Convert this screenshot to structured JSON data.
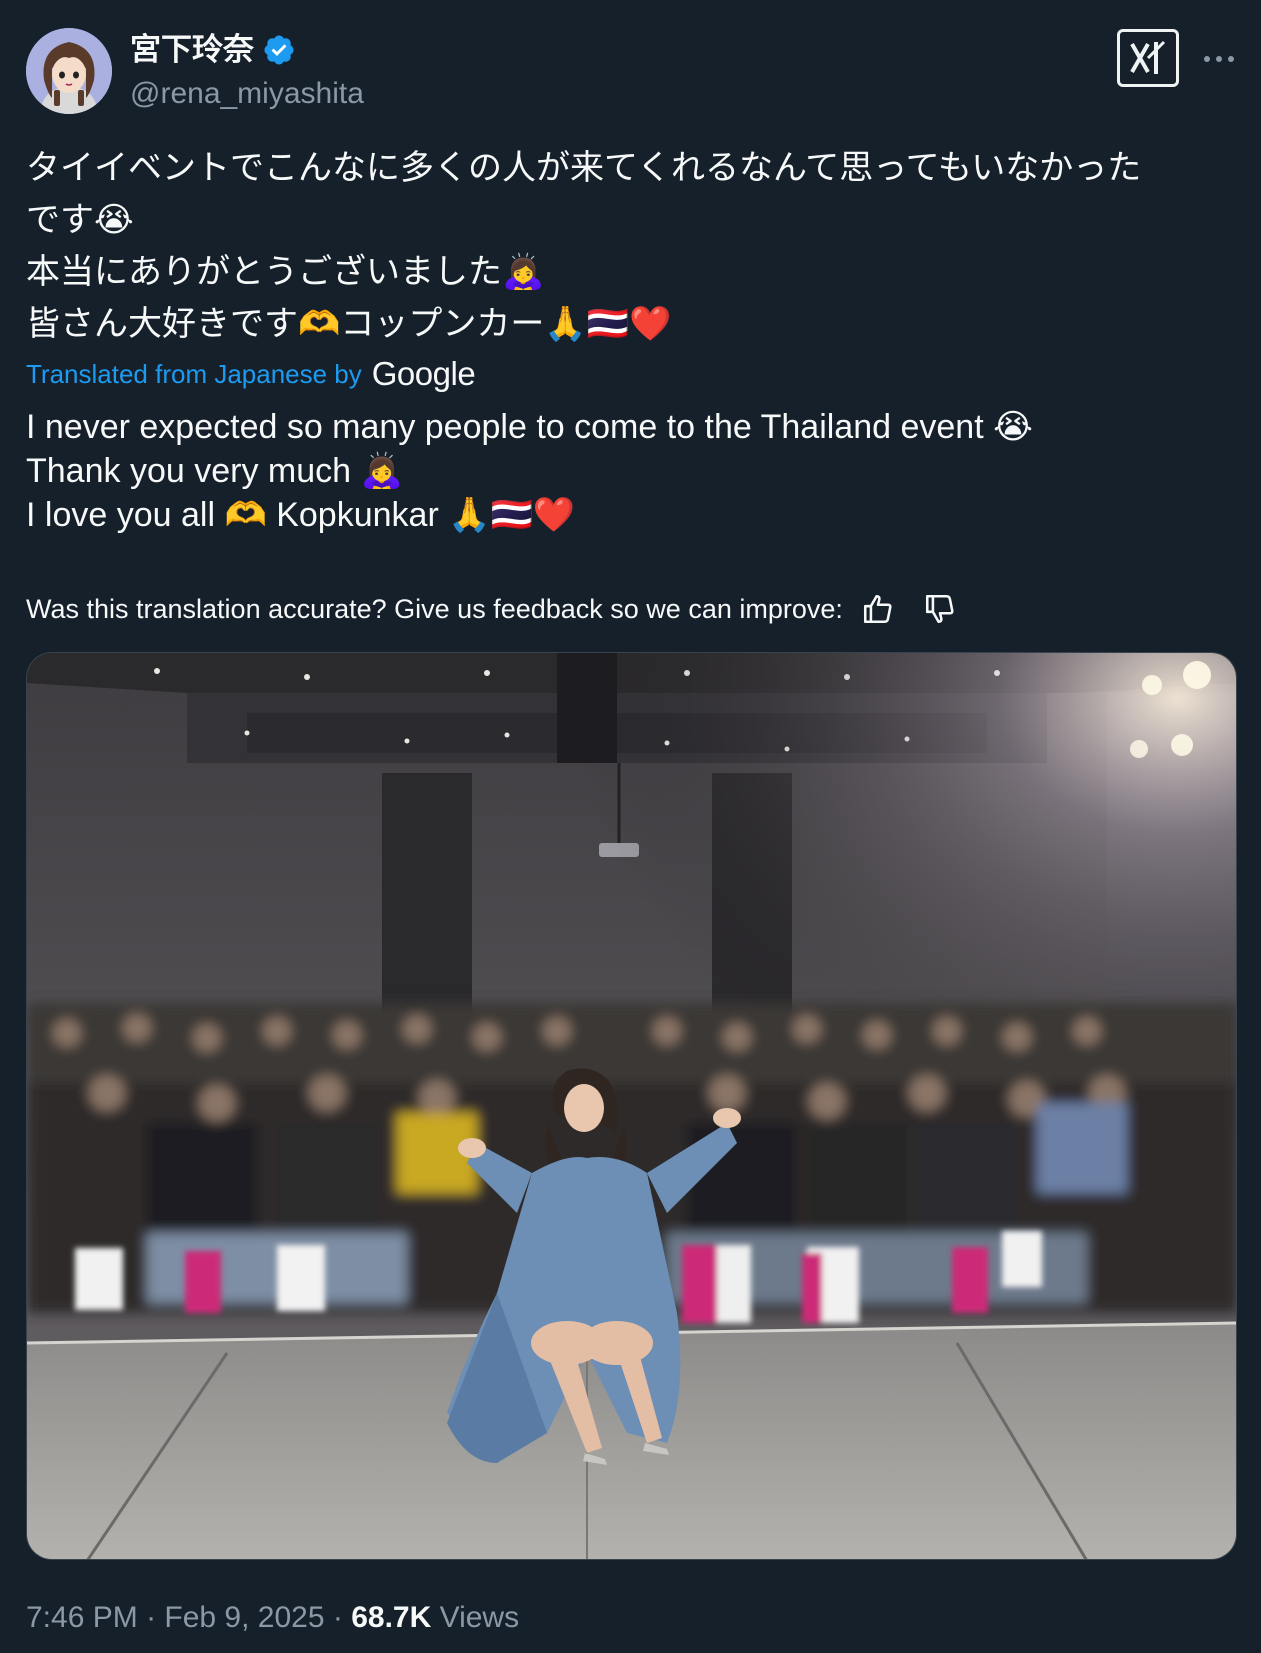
{
  "author": {
    "display_name": "宮下玲奈",
    "handle": "@rena_miyashita",
    "verified": true,
    "verified_color": "#1d9bf0"
  },
  "header_actions": {
    "grok_icon": "grok-icon",
    "more_icon": "more-icon"
  },
  "original_text": {
    "lines": [
      {
        "text": "タイイベントでこんなに多くの人が来てくれるなんて思ってもいなかった",
        "emoji": ""
      },
      {
        "text": "です",
        "emoji": "😭"
      },
      {
        "text": "本当にありがとうございました",
        "emoji": "🙇‍♀️"
      },
      {
        "text": "皆さん大好きです🫶コップンカー",
        "emoji": "🙏🇹🇭❤️"
      }
    ]
  },
  "translation": {
    "prefix": "Translated from Japanese by",
    "provider": "Google",
    "lines": [
      {
        "text": "I never expected so many people to come to the Thailand event ",
        "emoji": "😭"
      },
      {
        "text": "Thank you very much ",
        "emoji": "🙇‍♀️"
      },
      {
        "text": "I love you all 🫶 Kopkunkar ",
        "emoji": "🙏🇹🇭❤️"
      }
    ],
    "feedback_prompt": "Was this translation accurate? Give us feedback so we can improve:"
  },
  "media": {
    "alt": ""
  },
  "meta": {
    "time": "7:46 PM",
    "separator": " · ",
    "date": "Feb 9, 2025",
    "views_count": "68.7K",
    "views_label": " Views"
  },
  "colors": {
    "background": "#15202b",
    "text_primary": "#f7f9f9",
    "text_secondary": "#8b98a5",
    "link": "#1d9bf0"
  }
}
